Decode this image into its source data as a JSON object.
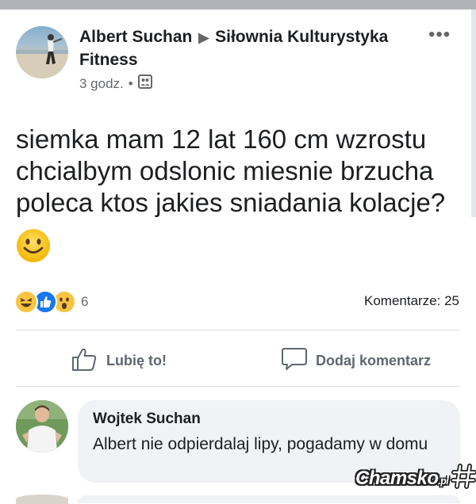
{
  "post": {
    "author": "Albert Suchan",
    "group": "Siłownia Kulturystyka Fitness",
    "time": "3 godz.",
    "separator": "•",
    "text": "siemka mam 12 lat 160 cm wzrostu chcialbym odslonic miesnie brzucha poleca ktos jakies sniadania kolacje?",
    "reactions_count": "6",
    "comments_label": "Komentarze: 25"
  },
  "actions": {
    "like_label": "Lubię to!",
    "comment_label": "Dodaj komentarz"
  },
  "comment": {
    "author": "Wojtek Suchan",
    "text": "Albert nie odpierdalaj lipy, pogadamy w domu"
  },
  "watermark": {
    "main": "Chamsko",
    "suffix": ".pl"
  },
  "colors": {
    "text": "#1c1e21",
    "secondary": "#65676b",
    "like_blue": "#1877f2",
    "reaction_yellow": "#f7c443",
    "bubble_bg": "#f0f2f5"
  },
  "icons": [
    "more-options-icon",
    "audience-icon",
    "laugh-reaction-icon",
    "like-reaction-icon",
    "wow-reaction-icon",
    "thumbs-up-icon",
    "comment-bubble-icon"
  ]
}
